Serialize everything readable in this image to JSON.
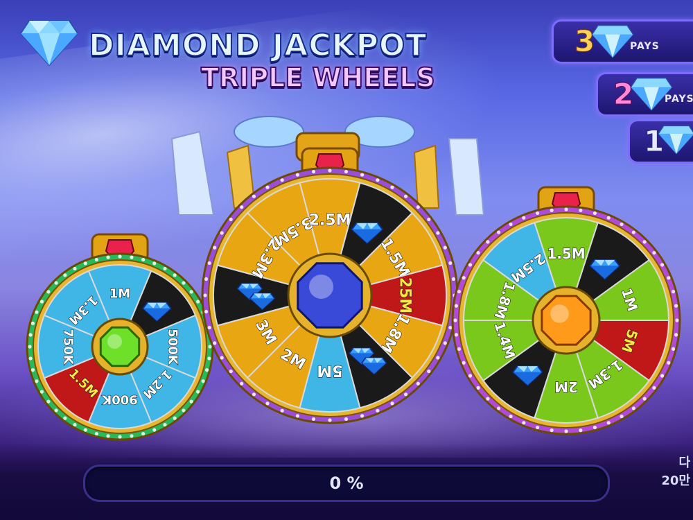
{
  "title": {
    "line1": "DIAMOND JACKPOT",
    "line2": "TRIPLE WHEELS",
    "logo_icon": "diamond-icon"
  },
  "pays": [
    {
      "count": "3",
      "label": "PAYS",
      "icon": "diamond-icon"
    },
    {
      "count": "2",
      "label": "PAYS",
      "icon": "diamond-icon"
    },
    {
      "count": "1",
      "label": "",
      "icon": "diamond-icon"
    }
  ],
  "wheels": {
    "left": {
      "center_gem": "green-gem-icon",
      "segments": [
        "1M",
        "diamond",
        "500K",
        "1.2M",
        "900K",
        "1.5M",
        "750K",
        "1.3M"
      ]
    },
    "middle": {
      "center_gem": "blue-gem-icon",
      "segments": [
        "2.5M",
        "diamond",
        "1.5M",
        "25M",
        "1.8M",
        "diamonds",
        "5M",
        "2M",
        "3M",
        "diamonds",
        "2.3M",
        "3.5M"
      ]
    },
    "right": {
      "center_gem": "orange-gem-icon",
      "segments": [
        "1.5M",
        "diamond",
        "1M",
        "5M",
        "1.3M",
        "2M",
        "diamond",
        "1.4M",
        "1.8M",
        "2.5M"
      ]
    }
  },
  "progress": {
    "value": 0,
    "text": "0 %"
  },
  "side_text": {
    "line1": "다",
    "line2": "20만"
  },
  "colors": {
    "gold_segment": "#e8a712",
    "black_segment": "#1a1a1a",
    "red_segment": "#c01818",
    "cyan_segment": "#3fb6e6",
    "lime_segment": "#7bc81c",
    "highlight_text": "#ffe640"
  }
}
